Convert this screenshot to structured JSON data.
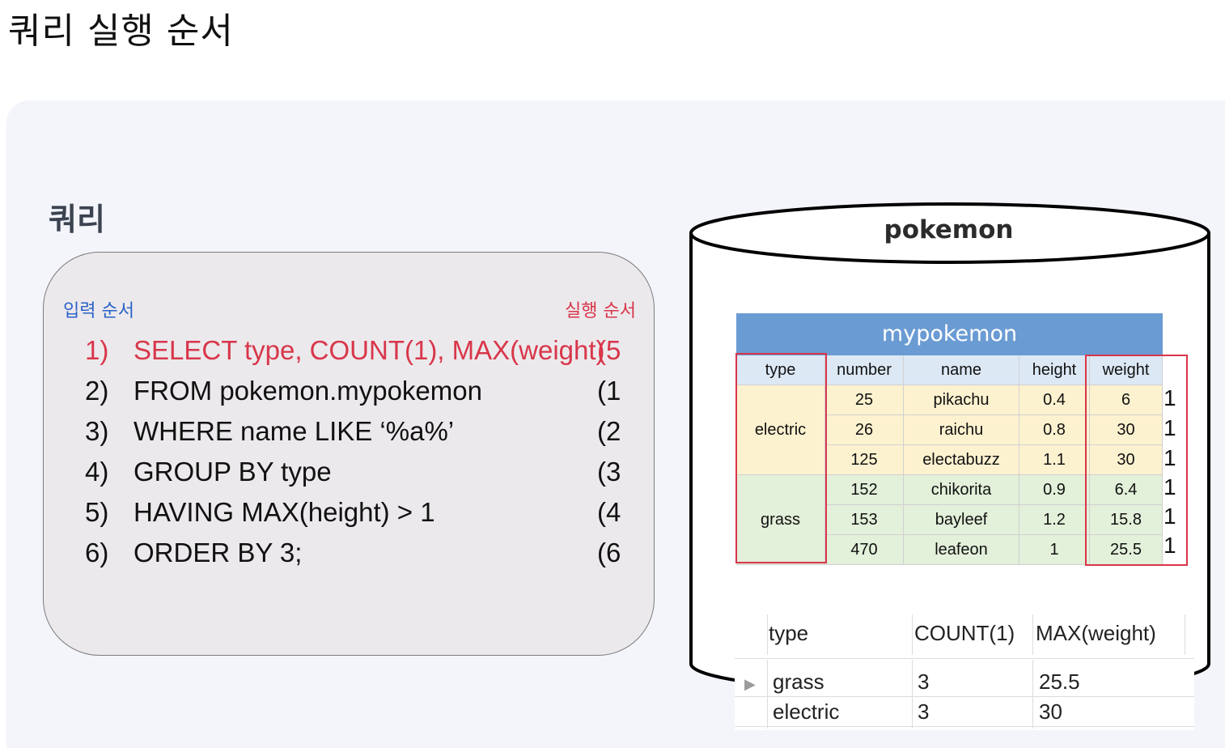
{
  "page": {
    "title": "쿼리 실행 순서"
  },
  "section": {
    "title": "쿼리"
  },
  "query": {
    "input_label": "입력 순서",
    "exec_label": "실행 순서",
    "lines": [
      {
        "num": "1)",
        "text": "SELECT type, COUNT(1), MAX(weight)",
        "order": "(5"
      },
      {
        "num": "2)",
        "text": "FROM pokemon.mypokemon",
        "order": "(1"
      },
      {
        "num": "3)",
        "text": "WHERE name LIKE ‘%a%’",
        "order": "(2"
      },
      {
        "num": "4)",
        "text": "GROUP BY type",
        "order": "(3"
      },
      {
        "num": "5)",
        "text": "HAVING MAX(height) > 1",
        "order": "(4"
      },
      {
        "num": "6)",
        "text": "ORDER BY 3;",
        "order": "(6"
      }
    ]
  },
  "database": {
    "name": "pokemon",
    "table": {
      "name": "mypokemon",
      "columns": [
        "type",
        "number",
        "name",
        "height",
        "weight"
      ],
      "groups": [
        {
          "type": "electric",
          "rows": [
            [
              "25",
              "pikachu",
              "0.4",
              "6"
            ],
            [
              "26",
              "raichu",
              "0.8",
              "30"
            ],
            [
              "125",
              "electabuzz",
              "1.1",
              "30"
            ]
          ]
        },
        {
          "type": "grass",
          "rows": [
            [
              "152",
              "chikorita",
              "0.9",
              "6.4"
            ],
            [
              "153",
              "bayleef",
              "1.2",
              "15.8"
            ],
            [
              "470",
              "leafeon",
              "1",
              "25.5"
            ]
          ]
        }
      ],
      "count_markers": [
        "1",
        "1",
        "1",
        "1",
        "1",
        "1"
      ]
    }
  },
  "result": {
    "columns": [
      "type",
      "COUNT(1)",
      "MAX(weight)"
    ],
    "rows": [
      [
        "grass",
        "3",
        "25.5"
      ],
      [
        "electric",
        "3",
        "30"
      ]
    ],
    "row_pointer": "▶"
  },
  "colors": {
    "highlight": "#d8364a",
    "input_label": "#2a63c8",
    "table_header": "#6a9bd3"
  }
}
